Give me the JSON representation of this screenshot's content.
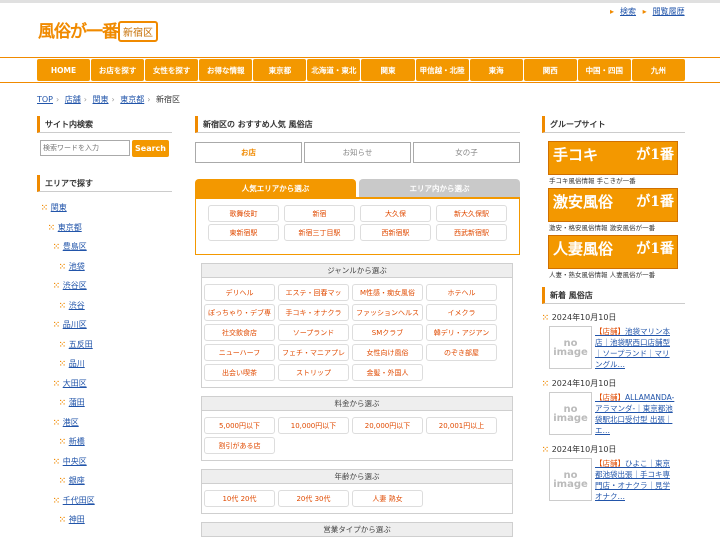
{
  "header": {
    "logo": "風俗が一番",
    "area_badge": "新宿区",
    "links": [
      "検索",
      "閲覧履歴"
    ]
  },
  "nav": [
    "HOME",
    "お店を探す",
    "女性を探す",
    "お得な情報",
    "東京都",
    "北海道・東北",
    "関東",
    "甲信越・北陸",
    "東海",
    "関西",
    "中国・四国",
    "九州"
  ],
  "breadcrumb": {
    "items": [
      "TOP",
      "店舗",
      "関東",
      "東京都"
    ],
    "current": "新宿区",
    "sep": "›"
  },
  "left": {
    "search_title": "サイト内検索",
    "search_placeholder": "検索ワードを入力",
    "search_button": "Search",
    "area_title": "エリアで探す",
    "areas": [
      "関東",
      "東京都",
      "豊島区",
      "池袋",
      "渋谷区",
      "渋谷",
      "品川区",
      "五反田",
      "品川",
      "大田区",
      "蒲田",
      "港区",
      "新橋",
      "中央区",
      "銀座",
      "千代田区",
      "神田"
    ]
  },
  "main": {
    "title": "新宿区の おすすめ人気 風俗店",
    "tabs": [
      "お店",
      "お知らせ",
      "女の子"
    ],
    "area_tabs": [
      "人気エリアから選ぶ",
      "エリア内から選ぶ"
    ],
    "areas": [
      [
        "歌舞伎町",
        "新宿",
        "大久保",
        "新大久保駅"
      ],
      [
        "東新宿駅",
        "新宿三丁目駅",
        "西新宿駅",
        "西武新宿駅"
      ]
    ],
    "genre_title": "ジャンルから選ぶ",
    "genres": [
      [
        "デリヘル",
        "エステ・回春マッ",
        "M性感・痴女風俗",
        "ホテヘル"
      ],
      [
        "ぽっちゃり・デブ専",
        "手コキ・オナクラ",
        "ファッションヘルス",
        "イメクラ"
      ],
      [
        "社交飲食店",
        "ソープランド",
        "SMクラブ",
        "韓デリ・アジアン"
      ],
      [
        "ニューハーフ",
        "フェチ・マニアプレ",
        "女性向け風俗",
        "のぞき部屋"
      ],
      [
        "出会い喫茶",
        "ストリップ",
        "金髪・外国人"
      ]
    ],
    "price_title": "料金から選ぶ",
    "prices": [
      [
        "5,000円以下",
        "10,000円以下",
        "20,000円以下",
        "20,001円以上"
      ],
      [
        "割引がある店"
      ]
    ],
    "age_title": "年齢から選ぶ",
    "ages": [
      [
        "10代 20代",
        "20代 30代",
        "人妻 熟女"
      ]
    ],
    "type_title": "営業タイプから選ぶ"
  },
  "right": {
    "group_title": "グループサイト",
    "banners": [
      {
        "main": "手コキ",
        "num": "が1番",
        "sub": "手コキ風俗情報 手こきが一番"
      },
      {
        "main": "激安風俗",
        "num": "が1番",
        "sub": "激安・格安風俗情報 激安風俗が一番"
      },
      {
        "main": "人妻風俗",
        "num": "が1番",
        "sub": "人妻・熟女風俗情報 人妻風俗が一番"
      }
    ],
    "new_title": "新着 風俗店",
    "noimage": "no image",
    "news": [
      {
        "date": "2024年10月10日",
        "tag": "【店舗】",
        "text": "池袋マリン本店｜池袋駅西口店舗型｜ソープランド｜マリングル…"
      },
      {
        "date": "2024年10月10日",
        "tag": "【店舗】",
        "text": "ALLAMANDA-アラマンダ-｜東京都池袋駅北口受付型 出張｜エ…"
      },
      {
        "date": "2024年10月10日",
        "tag": "【店舗】",
        "text": "ひよこ｜東京都池袋出張｜手コキ専門店・オナクラ｜見学オナク…"
      }
    ]
  }
}
